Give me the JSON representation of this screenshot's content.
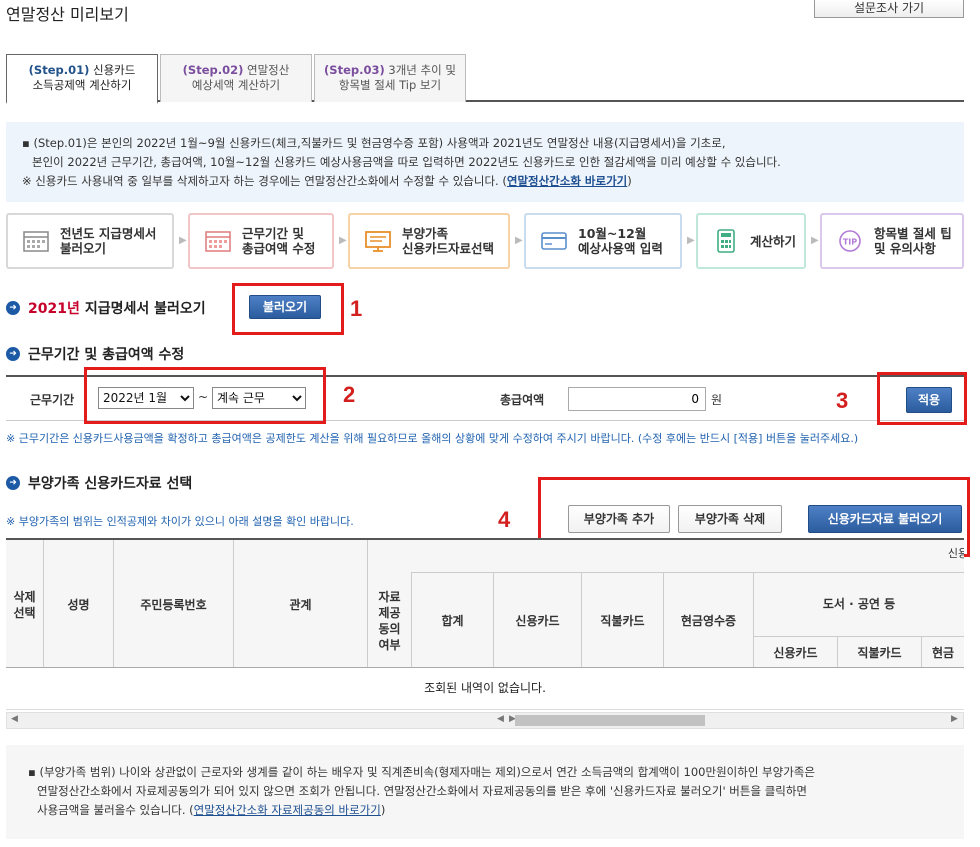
{
  "header": {
    "title": "연말정산 미리보기",
    "survey_label": "설문조사 가기"
  },
  "tabs": [
    {
      "step": "(Step.01)",
      "line1": "신용카드",
      "line2": "소득공제액 계산하기"
    },
    {
      "step": "(Step.02)",
      "line1": "연말정산",
      "line2": "예상세액 계산하기"
    },
    {
      "step": "(Step.03)",
      "line1": "3개년 추이 및",
      "line2": "항목별 절세 Tip 보기"
    }
  ],
  "info": {
    "line1": "(Step.01)은 본인의 2022년 1월~9월 신용카드(체크,직불카드 및 현금영수증 포함) 사용액과 2021년도 연말정산 내용(지급명세서)을 기초로,",
    "line2": "본인이 2022년 근무기간, 총급여액, 10월~12월 신용카드 예상사용금액을 따로 입력하면 2022년도 신용카드로 인한 절감세액을 미리 예상할 수 있습니다.",
    "line3": "※ 신용카드 사용내역 중 일부를 삭제하고자 하는 경우에는 연말정산간소화에서 수정할 수 있습니다.",
    "link": "연말정산간소화 바로가기"
  },
  "steps": [
    {
      "line1": "전년도 지급명세서",
      "line2": "불러오기",
      "icon": "calendar-icon"
    },
    {
      "line1": "근무기간 및",
      "line2": "총급여액 수정",
      "icon": "schedule-icon"
    },
    {
      "line1": "부양가족",
      "line2": "신용카드자료선택",
      "icon": "monitor-icon"
    },
    {
      "line1": "10월~12월",
      "line2": "예상사용액 입력",
      "icon": "card-icon"
    },
    {
      "line1": "계산하기",
      "line2": "",
      "icon": "calculator-icon"
    },
    {
      "line1": "항목별 절세 팁",
      "line2": "및 유의사항",
      "icon": "tip-icon"
    }
  ],
  "section1": {
    "year": "2021년",
    "title": "지급명세서 불러오기",
    "button": "불러오기"
  },
  "section2": {
    "title": "근무기간 및 총급여액 수정",
    "period_label": "근무기간",
    "start_value": "2022년 1월",
    "tilde": "~",
    "end_value": "계속 근무",
    "salary_label": "총급여액",
    "salary_value": "0",
    "unit": "원",
    "apply": "적용",
    "note": "※ 근무기간은 신용카드사용금액을 확정하고 총급여액은 공제한도 계산을 위해 필요하므로 올해의 상황에 맞게 수정하여 주시기 바랍니다. (수정 후에는 반드시 [적용] 버튼을 눌러주세요.)"
  },
  "section3": {
    "title": "부양가족 신용카드자료 선택",
    "note": "※ 부양가족의 범위는 인적공제와 차이가 있으니 아래 설명을 확인 바랍니다.",
    "add": "부양가족 추가",
    "delete": "부양가족 삭제",
    "load": "신용카드자료 불러오기"
  },
  "table": {
    "cols": {
      "select": "삭제 선택",
      "name": "성명",
      "rrn": "주민등록번호",
      "relation": "관계",
      "consent": "자료 제공 동의 여부",
      "total": "합계",
      "credit": "신용카드",
      "debit": "직불카드",
      "cash": "현금영수증",
      "books": "도서 · 공연 등",
      "sub_credit": "신용카드",
      "sub_debit": "직불카드",
      "sub_cash": "현금",
      "top_partial": "신용"
    },
    "empty": "조회된 내역이 없습니다."
  },
  "markers": {
    "m1": "1",
    "m2": "2",
    "m3": "3",
    "m4": "4"
  },
  "footer": {
    "line1": "(부양가족 범위) 나이와 상관없이 근로자와 생계를 같이 하는 배우자 및 직계존비속(형제자매는 제외)으로서 연간 소득금액의 합계액이 100만원이하인 부양가족은",
    "line2": "연말정산간소화에서 자료제공동의가 되어 있지 않으면 조회가 안됩니다. 연말정산간소화에서 자료제공동의를 받은 후에 '신용카드자료 불러오기' 버튼을 클릭하면",
    "line3": "사용금액을 불러올수 있습니다.",
    "link": "연말정산간소화 자료제공동의 바로가기"
  },
  "colors": {
    "accent": "#2a5c9e",
    "marker": "#e31b1b"
  }
}
